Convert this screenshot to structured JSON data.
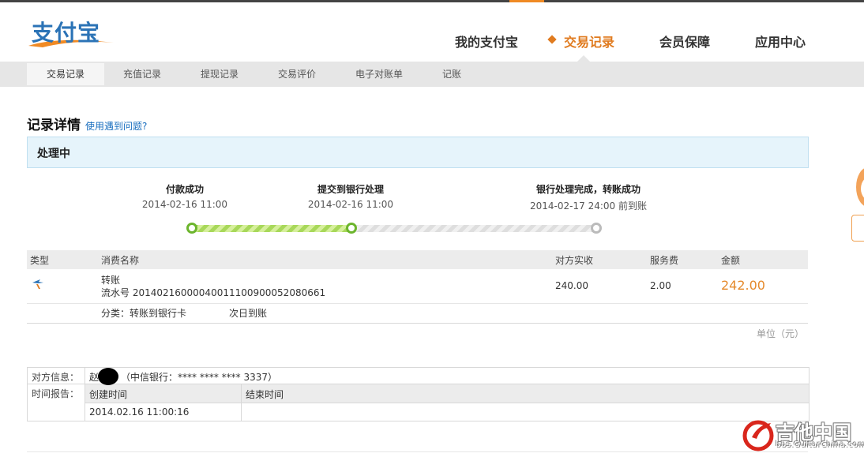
{
  "brand": {
    "logo_text": "支付宝"
  },
  "main_nav": [
    {
      "label": "我的支付宝",
      "active": false
    },
    {
      "label": "交易记录",
      "active": true
    },
    {
      "label": "会员保障",
      "active": false
    },
    {
      "label": "应用中心",
      "active": false
    }
  ],
  "sub_nav": [
    {
      "label": "交易记录",
      "active": true
    },
    {
      "label": "充值记录",
      "active": false
    },
    {
      "label": "提现记录",
      "active": false
    },
    {
      "label": "交易评价",
      "active": false
    },
    {
      "label": "电子对账单",
      "active": false
    },
    {
      "label": "记账",
      "active": false
    }
  ],
  "page": {
    "title": "记录详情",
    "help_link": "使用遇到问题?",
    "status": "处理中"
  },
  "progress": {
    "steps": [
      {
        "title": "付款成功",
        "time": "2014-02-16 11:00"
      },
      {
        "title": "提交到银行处理",
        "time": "2014-02-16 11:00"
      },
      {
        "title": "银行处理完成，转账成功",
        "time": "2014-02-17 24:00 前到账"
      }
    ],
    "completed_steps": 2
  },
  "table": {
    "headers": {
      "type": "类型",
      "name": "消费名称",
      "received": "对方实收",
      "fee": "服务费",
      "amount": "金额"
    },
    "row": {
      "type_icon": "transfer-icon",
      "name": "转账",
      "serial": "流水号 20140216000040011100900052080661",
      "received": "240.00",
      "fee": "2.00",
      "amount": "242.00"
    },
    "category": "分类：转账到银行卡",
    "arrival": "次日到账",
    "unit": "单位（元）"
  },
  "info": {
    "counterparty_label": "对方信息：",
    "counterparty_value": "赵",
    "bank_info": "（中信银行：**** **** **** 3337）",
    "time_label": "时间报告：",
    "created_header": "创建时间",
    "end_header": "结束时间",
    "created_value": "2014.02.16 11:00:16"
  },
  "watermark": {
    "title": "吉他中国",
    "url": "bbs.GuitarChina.com"
  },
  "colors": {
    "accent": "#e07b1f",
    "link": "#1a6fbf",
    "progress_done": "#6cb52d",
    "amount": "#e58a2c"
  }
}
